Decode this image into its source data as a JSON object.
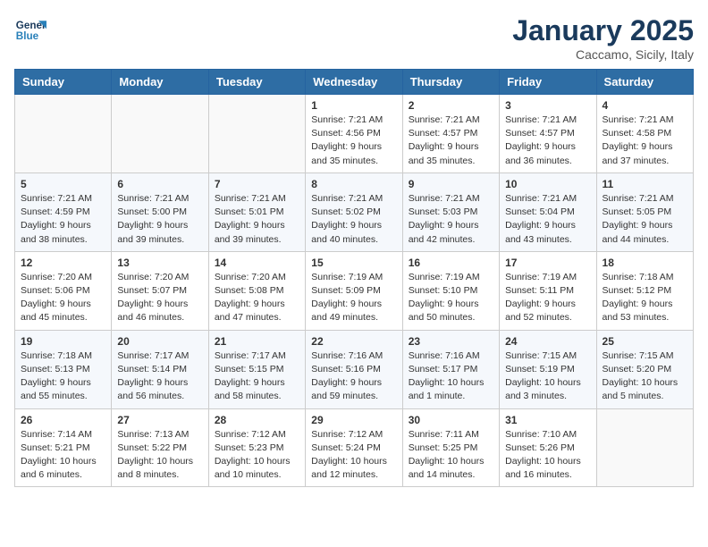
{
  "logo": {
    "line1": "General",
    "line2": "Blue"
  },
  "title": "January 2025",
  "subtitle": "Caccamo, Sicily, Italy",
  "days_of_week": [
    "Sunday",
    "Monday",
    "Tuesday",
    "Wednesday",
    "Thursday",
    "Friday",
    "Saturday"
  ],
  "weeks": [
    [
      {
        "day": "",
        "info": ""
      },
      {
        "day": "",
        "info": ""
      },
      {
        "day": "",
        "info": ""
      },
      {
        "day": "1",
        "info": "Sunrise: 7:21 AM\nSunset: 4:56 PM\nDaylight: 9 hours and 35 minutes."
      },
      {
        "day": "2",
        "info": "Sunrise: 7:21 AM\nSunset: 4:57 PM\nDaylight: 9 hours and 35 minutes."
      },
      {
        "day": "3",
        "info": "Sunrise: 7:21 AM\nSunset: 4:57 PM\nDaylight: 9 hours and 36 minutes."
      },
      {
        "day": "4",
        "info": "Sunrise: 7:21 AM\nSunset: 4:58 PM\nDaylight: 9 hours and 37 minutes."
      }
    ],
    [
      {
        "day": "5",
        "info": "Sunrise: 7:21 AM\nSunset: 4:59 PM\nDaylight: 9 hours and 38 minutes."
      },
      {
        "day": "6",
        "info": "Sunrise: 7:21 AM\nSunset: 5:00 PM\nDaylight: 9 hours and 39 minutes."
      },
      {
        "day": "7",
        "info": "Sunrise: 7:21 AM\nSunset: 5:01 PM\nDaylight: 9 hours and 39 minutes."
      },
      {
        "day": "8",
        "info": "Sunrise: 7:21 AM\nSunset: 5:02 PM\nDaylight: 9 hours and 40 minutes."
      },
      {
        "day": "9",
        "info": "Sunrise: 7:21 AM\nSunset: 5:03 PM\nDaylight: 9 hours and 42 minutes."
      },
      {
        "day": "10",
        "info": "Sunrise: 7:21 AM\nSunset: 5:04 PM\nDaylight: 9 hours and 43 minutes."
      },
      {
        "day": "11",
        "info": "Sunrise: 7:21 AM\nSunset: 5:05 PM\nDaylight: 9 hours and 44 minutes."
      }
    ],
    [
      {
        "day": "12",
        "info": "Sunrise: 7:20 AM\nSunset: 5:06 PM\nDaylight: 9 hours and 45 minutes."
      },
      {
        "day": "13",
        "info": "Sunrise: 7:20 AM\nSunset: 5:07 PM\nDaylight: 9 hours and 46 minutes."
      },
      {
        "day": "14",
        "info": "Sunrise: 7:20 AM\nSunset: 5:08 PM\nDaylight: 9 hours and 47 minutes."
      },
      {
        "day": "15",
        "info": "Sunrise: 7:19 AM\nSunset: 5:09 PM\nDaylight: 9 hours and 49 minutes."
      },
      {
        "day": "16",
        "info": "Sunrise: 7:19 AM\nSunset: 5:10 PM\nDaylight: 9 hours and 50 minutes."
      },
      {
        "day": "17",
        "info": "Sunrise: 7:19 AM\nSunset: 5:11 PM\nDaylight: 9 hours and 52 minutes."
      },
      {
        "day": "18",
        "info": "Sunrise: 7:18 AM\nSunset: 5:12 PM\nDaylight: 9 hours and 53 minutes."
      }
    ],
    [
      {
        "day": "19",
        "info": "Sunrise: 7:18 AM\nSunset: 5:13 PM\nDaylight: 9 hours and 55 minutes."
      },
      {
        "day": "20",
        "info": "Sunrise: 7:17 AM\nSunset: 5:14 PM\nDaylight: 9 hours and 56 minutes."
      },
      {
        "day": "21",
        "info": "Sunrise: 7:17 AM\nSunset: 5:15 PM\nDaylight: 9 hours and 58 minutes."
      },
      {
        "day": "22",
        "info": "Sunrise: 7:16 AM\nSunset: 5:16 PM\nDaylight: 9 hours and 59 minutes."
      },
      {
        "day": "23",
        "info": "Sunrise: 7:16 AM\nSunset: 5:17 PM\nDaylight: 10 hours and 1 minute."
      },
      {
        "day": "24",
        "info": "Sunrise: 7:15 AM\nSunset: 5:19 PM\nDaylight: 10 hours and 3 minutes."
      },
      {
        "day": "25",
        "info": "Sunrise: 7:15 AM\nSunset: 5:20 PM\nDaylight: 10 hours and 5 minutes."
      }
    ],
    [
      {
        "day": "26",
        "info": "Sunrise: 7:14 AM\nSunset: 5:21 PM\nDaylight: 10 hours and 6 minutes."
      },
      {
        "day": "27",
        "info": "Sunrise: 7:13 AM\nSunset: 5:22 PM\nDaylight: 10 hours and 8 minutes."
      },
      {
        "day": "28",
        "info": "Sunrise: 7:12 AM\nSunset: 5:23 PM\nDaylight: 10 hours and 10 minutes."
      },
      {
        "day": "29",
        "info": "Sunrise: 7:12 AM\nSunset: 5:24 PM\nDaylight: 10 hours and 12 minutes."
      },
      {
        "day": "30",
        "info": "Sunrise: 7:11 AM\nSunset: 5:25 PM\nDaylight: 10 hours and 14 minutes."
      },
      {
        "day": "31",
        "info": "Sunrise: 7:10 AM\nSunset: 5:26 PM\nDaylight: 10 hours and 16 minutes."
      },
      {
        "day": "",
        "info": ""
      }
    ]
  ]
}
